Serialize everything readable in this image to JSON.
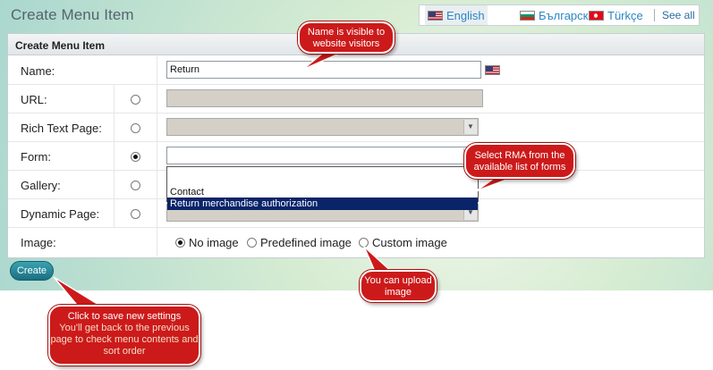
{
  "page": {
    "title": "Create Menu Item"
  },
  "languages": [
    {
      "label": "English",
      "icon": "us-flag-icon",
      "active": true
    },
    {
      "label": "Български",
      "icon": "bulgaria-flag-icon",
      "active": false
    },
    {
      "label": "Türkçe",
      "icon": "turkey-flag-icon",
      "active": false
    }
  ],
  "see_all": "See all",
  "panel": {
    "header": "Create Menu Item"
  },
  "form": {
    "name": {
      "label": "Name:",
      "value": "Return",
      "icon": "us-flag-icon"
    },
    "url": {
      "label": "URL:",
      "value": ""
    },
    "rich_text": {
      "label": "Rich Text Page:",
      "value": ""
    },
    "form_field": {
      "label": "Form:",
      "value": ""
    },
    "gallery": {
      "label": "Gallery:"
    },
    "dynamic": {
      "label": "Dynamic Page:",
      "value": ""
    },
    "image": {
      "label": "Image:",
      "options": [
        "No image",
        "Predefined image",
        "Custom image"
      ],
      "selected": "No image"
    },
    "form_options": [
      "Contact",
      "Return merchandise authorization"
    ],
    "form_selected_option": "Return merchandise authorization"
  },
  "create_button": "Create",
  "callouts": {
    "name": "Name is visible to website visitors",
    "form": "Select RMA from the available list of forms",
    "image": "You can upload image",
    "create_line1": "Click to save new settings",
    "create_line2": "You'll get back to the previous page to check menu contents and sort order"
  },
  "colors": {
    "accent": "#2b86c5",
    "callout": "#cc1a1a",
    "selection": "#0a246a",
    "button": "#1a6f80"
  }
}
